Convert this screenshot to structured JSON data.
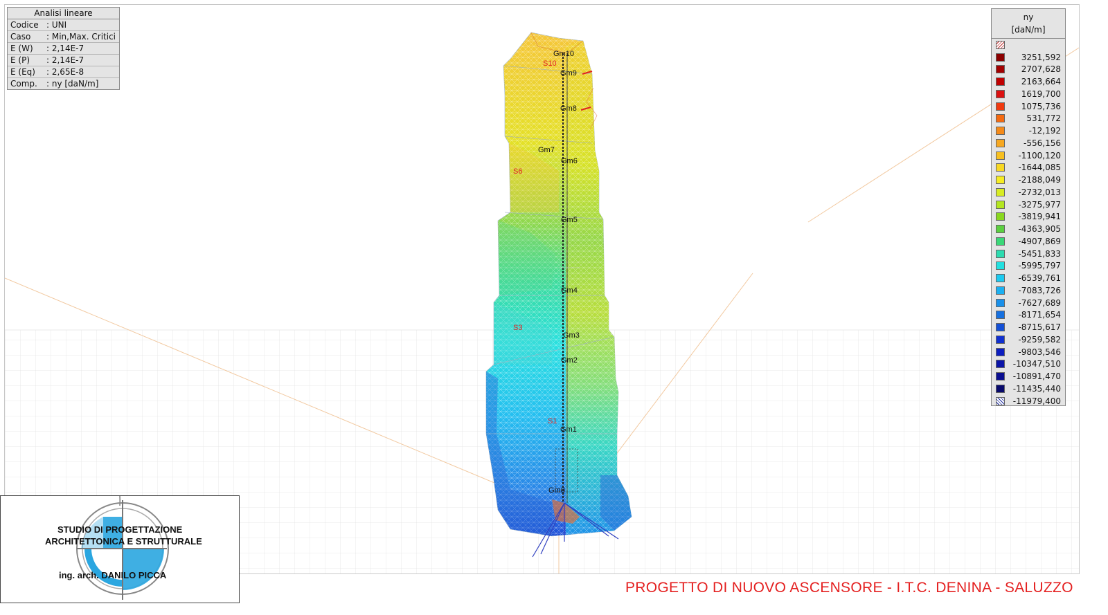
{
  "info_panel": {
    "title": "Analisi lineare",
    "rows": [
      {
        "key": "Codice",
        "value": ": UNI"
      },
      {
        "key": "Caso",
        "value": ": Min,Max. Critici"
      },
      {
        "key": "E (W)",
        "value": ": 2,14E-7"
      },
      {
        "key": "E (P)",
        "value": ": 2,14E-7"
      },
      {
        "key": "E (Eq)",
        "value": ": 2,65E-8"
      },
      {
        "key": "Comp.",
        "value": ": ny [daN/m]"
      }
    ]
  },
  "legend": {
    "title": "ny",
    "unit": "[daN/m]",
    "entries": [
      {
        "value": "3251,592",
        "color": "#8b0000"
      },
      {
        "value": "2707,628",
        "color": "#a30000"
      },
      {
        "value": "2163,664",
        "color": "#c00000"
      },
      {
        "value": "1619,700",
        "color": "#dc1010"
      },
      {
        "value": "1075,736",
        "color": "#f03a10"
      },
      {
        "value": "531,772",
        "color": "#f56a10"
      },
      {
        "value": "-12,192",
        "color": "#f58a18"
      },
      {
        "value": "-556,156",
        "color": "#f7a821"
      },
      {
        "value": "-1100,120",
        "color": "#f8c020"
      },
      {
        "value": "-1644,085",
        "color": "#f8d823"
      },
      {
        "value": "-2188,049",
        "color": "#f6ec22"
      },
      {
        "value": "-2732,013",
        "color": "#d8ec22"
      },
      {
        "value": "-3275,977",
        "color": "#b4e620"
      },
      {
        "value": "-3819,941",
        "color": "#8ad820"
      },
      {
        "value": "-4363,905",
        "color": "#5cd040"
      },
      {
        "value": "-4907,869",
        "color": "#3ad878"
      },
      {
        "value": "-5451,833",
        "color": "#2cdcb0"
      },
      {
        "value": "-5995,797",
        "color": "#22e0e0"
      },
      {
        "value": "-6539,761",
        "color": "#1ccaf0"
      },
      {
        "value": "-7083,726",
        "color": "#1ab0f2"
      },
      {
        "value": "-7627,689",
        "color": "#1890ea"
      },
      {
        "value": "-8171,654",
        "color": "#1670e0"
      },
      {
        "value": "-8715,617",
        "color": "#1450d6"
      },
      {
        "value": "-9259,582",
        "color": "#1030d0"
      },
      {
        "value": "-9803,546",
        "color": "#0c1ec0"
      },
      {
        "value": "-10347,510",
        "color": "#0a14a8"
      },
      {
        "value": "-10891,470",
        "color": "#0a0e90"
      },
      {
        "value": "-11435,440",
        "color": "#080a6c"
      },
      {
        "value": "-11979,400",
        "color": "#1a2aa0"
      }
    ]
  },
  "model": {
    "node_labels": [
      "Gm10",
      "Gm9",
      "Gm8",
      "Gm7",
      "Gm6",
      "Gm5",
      "Gm4",
      "Gm3",
      "Gm2",
      "Gm1",
      "Gm0"
    ],
    "section_labels": [
      "S10",
      "S6",
      "S3",
      "S1"
    ]
  },
  "logo": {
    "line1": "STUDIO DI PROGETTAZIONE",
    "line2": "ARCHITETTONICA E STRUTTURALE",
    "line3": "ing. arch. DANILO PICCA"
  },
  "project_title": "PROGETTO DI NUOVO ASCENSORE - I.T.C. DENINA - SALUZZO"
}
